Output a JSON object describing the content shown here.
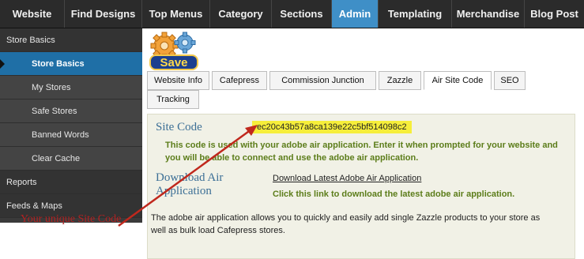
{
  "topnav": {
    "items": [
      {
        "label": "Website"
      },
      {
        "label": "Find Designs"
      },
      {
        "label": "Top Menus"
      },
      {
        "label": "Category"
      },
      {
        "label": "Sections"
      },
      {
        "label": "Admin",
        "active": true
      },
      {
        "label": "Templating"
      },
      {
        "label": "Merchandise"
      },
      {
        "label": "Blog Post"
      }
    ]
  },
  "sidebar": {
    "items": [
      {
        "label": "Store Basics"
      },
      {
        "label": "Store Basics",
        "selected": true
      },
      {
        "label": "My Stores"
      },
      {
        "label": "Safe Stores"
      },
      {
        "label": "Banned Words"
      },
      {
        "label": "Clear Cache"
      },
      {
        "label": "Reports"
      },
      {
        "label": "Feeds & Maps"
      }
    ]
  },
  "toolbar": {
    "save_label": "Save"
  },
  "tabs": [
    {
      "label": "Website Info"
    },
    {
      "label": "Cafepress"
    },
    {
      "label": "Commission Junction"
    },
    {
      "label": "Zazzle"
    },
    {
      "label": "Air Site Code",
      "active": true
    },
    {
      "label": "SEO"
    },
    {
      "label": "Tracking"
    }
  ],
  "panel": {
    "site_code_label": "Site Code",
    "site_code_value": "ec20c43b57a8ca139e22c5bf514098c2",
    "site_code_hint_1": "This code is used with your adobe air application. Enter it when prompted for your website and",
    "site_code_hint_2": "you will be able to connect and use the adobe air application.",
    "download_label_1": "Download Air",
    "download_label_2": "Application",
    "download_link": "Download Latest Adobe Air Application",
    "download_hint": "Click this link to download the latest adobe air application.",
    "description_1": "The adobe air application allows you to quickly and easily add single Zazzle products to your store as",
    "description_2": "well as bulk load Cafepress stores."
  },
  "annotation": {
    "callout": "Your unique Site Code"
  },
  "colors": {
    "nav_bg": "#2b2b2b",
    "nav_active": "#3f8fc7",
    "sidebar_bg": "#3a3a3a",
    "sidebar_selected": "#1f6fa6",
    "code_highlight": "#f6ee3a",
    "hint_green": "#5c7d1a",
    "label_blue": "#3c6f96",
    "callout_red": "#b22222"
  }
}
